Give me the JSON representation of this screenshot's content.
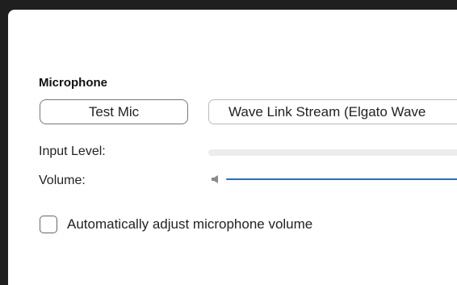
{
  "microphone": {
    "section_title": "Microphone",
    "test_button_label": "Test Mic",
    "device_selected": "Wave Link Stream (Elgato Wave",
    "input_level_label": "Input Level:",
    "input_level_value": 0,
    "volume_label": "Volume:",
    "auto_adjust_label": "Automatically adjust microphone volume",
    "auto_adjust_checked": false
  },
  "icons": {
    "volume": "speaker-icon",
    "checkbox": "checkbox-icon"
  },
  "colors": {
    "window_bg": "#1f1f1f",
    "panel_bg": "#ffffff",
    "slider_accent": "#1a73c9",
    "level_track": "#ececec"
  }
}
